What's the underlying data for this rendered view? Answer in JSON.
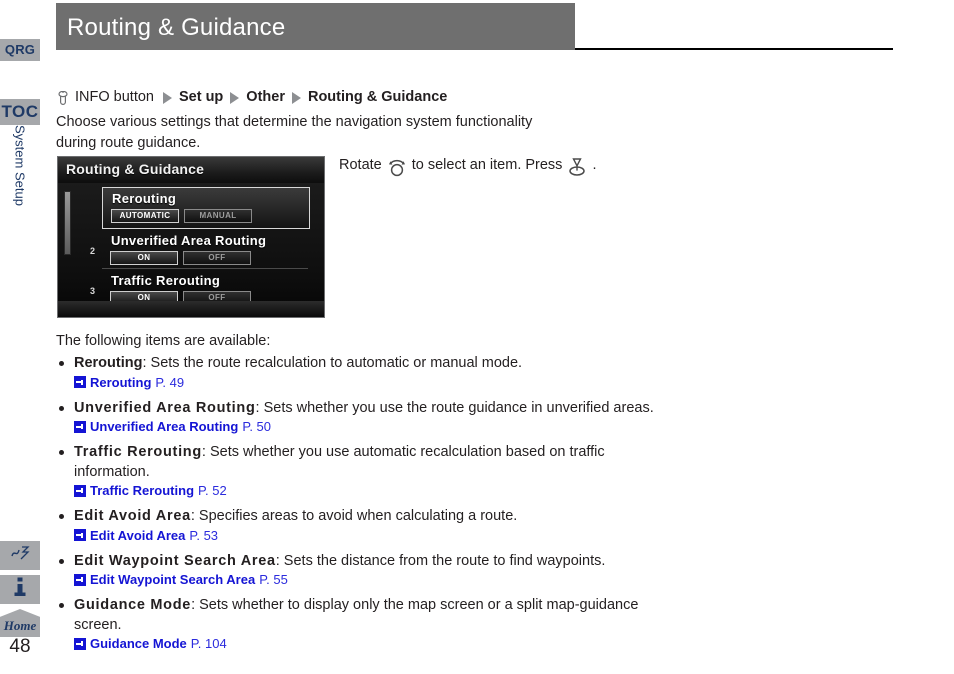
{
  "sidebar": {
    "tabs": [
      {
        "id": "qrg",
        "label": "QRG"
      },
      {
        "id": "toc",
        "label": "TOC"
      }
    ],
    "vertical_label": "System Setup",
    "icon_tabs": [
      {
        "id": "voice",
        "icon": "voice-command-icon"
      },
      {
        "id": "info",
        "icon": "information-icon"
      },
      {
        "id": "home",
        "icon": "home-icon",
        "label": "Home"
      }
    ],
    "page_number": "48"
  },
  "header": {
    "title": "Routing & Guidance"
  },
  "breadcrumb": {
    "knob_icon": "knob-button-icon",
    "items": [
      {
        "label": "INFO button",
        "bold": false
      },
      {
        "label": "Set up",
        "bold": true
      },
      {
        "label": "Other",
        "bold": true
      },
      {
        "label": "Routing & Guidance",
        "bold": true
      }
    ]
  },
  "intro": "Choose various settings that determine the navigation system functionality during route guidance.",
  "nav_screenshot": {
    "title": "Routing & Guidance",
    "rows": [
      {
        "number": "",
        "label": "Rerouting",
        "selected": true,
        "buttons": [
          {
            "label": "AUTOMATIC",
            "active": true
          },
          {
            "label": "MANUAL",
            "active": false
          }
        ]
      },
      {
        "number": "2",
        "label": "Unverified Area Routing",
        "selected": false,
        "buttons": [
          {
            "label": "ON",
            "active": true
          },
          {
            "label": "OFF",
            "active": false
          }
        ]
      },
      {
        "number": "3",
        "label": "Traffic Rerouting",
        "selected": false,
        "buttons": [
          {
            "label": "ON",
            "active": true
          },
          {
            "label": "OFF",
            "active": false
          }
        ]
      }
    ]
  },
  "rotate_hint": {
    "part1": "Rotate",
    "rotate_icon": "knob-rotate-icon",
    "part2": "to select an item. Press",
    "press_icon": "knob-press-icon",
    "part3": "."
  },
  "list_intro": "The following items are available:",
  "bullets": [
    {
      "term": "Rerouting",
      "spaced": false,
      "description": ": Sets the route recalculation to automatic or manual mode.",
      "xref_label": "Rerouting",
      "xref_page": "P. 49"
    },
    {
      "term": "Unverified Area Routing",
      "spaced": true,
      "description": ": Sets whether you use the route guidance in unverified areas.",
      "xref_label": "Unverified Area Routing",
      "xref_page": "P. 50"
    },
    {
      "term": "Traffic Rerouting",
      "spaced": true,
      "description": ": Sets whether you use automatic recalculation based on traffic information.",
      "xref_label": "Traffic Rerouting",
      "xref_page": "P. 52"
    },
    {
      "term": "Edit Avoid Area",
      "spaced": true,
      "description": ": Specifies areas to avoid when calculating a route.",
      "xref_label": "Edit Avoid Area",
      "xref_page": "P. 53"
    },
    {
      "term": "Edit Waypoint Search Area",
      "spaced": true,
      "description": ": Sets the distance from the route to find waypoints.",
      "xref_label": "Edit Waypoint Search Area",
      "xref_page": "P. 55"
    },
    {
      "term": "Guidance Mode",
      "spaced": true,
      "description": ": Sets whether to display only the map screen or a split map-guidance screen.",
      "xref_label": "Guidance Mode",
      "xref_page": "P. 104"
    }
  ],
  "colors": {
    "title_bar": "#6f6f6f",
    "tab_bg": "#a6a8ab",
    "tab_text": "#1f3a66",
    "link": "#1414d4",
    "text": "#231f20"
  }
}
